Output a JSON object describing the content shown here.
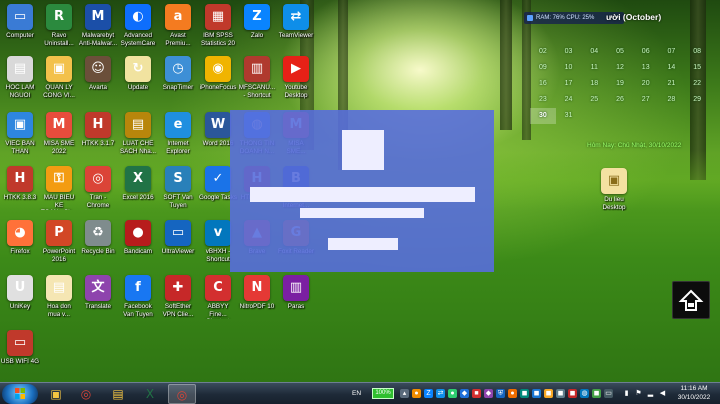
{
  "desktop_icons": [
    {
      "label": "Computer",
      "icon": "computer-icon",
      "color": "#3a7bd5",
      "glyph": "▭"
    },
    {
      "label": "Ravo\nUninstall...",
      "icon": "uninstaller-icon",
      "color": "#2b8a3e",
      "glyph": "R"
    },
    {
      "label": "Malwarebyt\nAnti-Malwar...",
      "icon": "malwarebytes-icon",
      "color": "#1b4fa8",
      "glyph": "M"
    },
    {
      "label": "Advanced\nSystemCare",
      "icon": "systemcare-icon",
      "color": "#0d6efd",
      "glyph": "◐"
    },
    {
      "label": "Avast\nPremiu...",
      "icon": "avast-icon",
      "color": "#f47b20",
      "glyph": "a"
    },
    {
      "label": "IBM SPSS\nStatistics 20",
      "icon": "spss-icon",
      "color": "#c0392b",
      "glyph": "▦"
    },
    {
      "label": "Zalo",
      "icon": "zalo-icon",
      "color": "#0a84ff",
      "glyph": "Z"
    },
    {
      "label": "TeamViewer",
      "icon": "teamviewer-icon",
      "color": "#0e8ee9",
      "glyph": "⇄"
    },
    {
      "label": "HOC LAM\nNGUOI",
      "icon": "document-icon",
      "color": "#d9d9d9",
      "glyph": "▤"
    },
    {
      "label": "QUAN LY\nCONG VI...",
      "icon": "folder-icon",
      "color": "#f3c14b",
      "glyph": "▣"
    },
    {
      "label": "Avarta",
      "icon": "photo-icon",
      "color": "#6b4f3a",
      "glyph": "☺"
    },
    {
      "label": "Update",
      "icon": "update-icon",
      "color": "#f1e3a0",
      "glyph": "↻"
    },
    {
      "label": "SnapTimer",
      "icon": "timer-icon",
      "color": "#3d8fd6",
      "glyph": "◷"
    },
    {
      "label": "iPhoneFocus",
      "icon": "iphonefocus-icon",
      "color": "#f0b400",
      "glyph": "◉"
    },
    {
      "label": "MFSCANU...\n- Shortcut",
      "icon": "scanner-icon",
      "color": "#b03a2e",
      "glyph": "▥"
    },
    {
      "label": "Youtube\nDesktop",
      "icon": "youtube-icon",
      "color": "#e62117",
      "glyph": "▶"
    },
    {
      "label": "VIEC BAN\nTHAN",
      "icon": "folder-icon",
      "color": "#2e86de",
      "glyph": "▣"
    },
    {
      "label": "MISA SME\n2022",
      "icon": "misa-icon",
      "color": "#e74c3c",
      "glyph": "M"
    },
    {
      "label": "HTKK 3.1.7",
      "icon": "htkk-icon",
      "color": "#c0392b",
      "glyph": "H"
    },
    {
      "label": "LUAT CHE\nSACH Nha...",
      "icon": "book-icon",
      "color": "#b8860b",
      "glyph": "▤"
    },
    {
      "label": "Internet\nExplorer",
      "icon": "internet-explorer-icon",
      "color": "#1f8fe0",
      "glyph": "e"
    },
    {
      "label": "Word 2016",
      "icon": "word-icon",
      "color": "#2b579a",
      "glyph": "W"
    },
    {
      "label": "THONG TIN\nDOANH N...",
      "icon": "globe-icon",
      "color": "#1e90ff",
      "glyph": "◍"
    },
    {
      "label": "MISA\nSME...",
      "icon": "misa-icon",
      "color": "#e74c3c",
      "glyph": "M"
    },
    {
      "label": "HTKK 3.8.3",
      "icon": "htkk-icon",
      "color": "#c0392b",
      "glyph": "H"
    },
    {
      "label": "MAU BIEU KE\nTOAN - Sh...",
      "icon": "key-icon",
      "color": "#f39c12",
      "glyph": "⚿"
    },
    {
      "label": "Tran -\nChrome",
      "icon": "chrome-icon",
      "color": "#db4437",
      "glyph": "◎"
    },
    {
      "label": "Excel 2016",
      "icon": "excel-icon",
      "color": "#217346",
      "glyph": "X"
    },
    {
      "label": "SOFT Van\nTuyen",
      "icon": "soft-icon",
      "color": "#2980b9",
      "glyph": "S"
    },
    {
      "label": "Google Tasks",
      "icon": "google-tasks-icon",
      "color": "#1a73e8",
      "glyph": "✓"
    },
    {
      "label": "HTKK 4.5.5",
      "icon": "htkk-icon",
      "color": "#c0392b",
      "glyph": "H"
    },
    {
      "label": "BKAV Pro\nInternet...",
      "icon": "bkav-icon",
      "color": "#0d47a1",
      "glyph": "B"
    },
    {
      "label": "Firefox",
      "icon": "firefox-icon",
      "color": "#ff7139",
      "glyph": "◕"
    },
    {
      "label": "PowerPoint\n2016",
      "icon": "powerpoint-icon",
      "color": "#d24726",
      "glyph": "P"
    },
    {
      "label": "Recycle Bin",
      "icon": "recycle-bin-icon",
      "color": "#7f8c8d",
      "glyph": "♻"
    },
    {
      "label": "Bandicam",
      "icon": "bandicam-icon",
      "color": "#b71c1c",
      "glyph": "●"
    },
    {
      "label": "UltraViewer",
      "icon": "ultraviewer-icon",
      "color": "#1565c0",
      "glyph": "▭"
    },
    {
      "label": "vBHXH -\nShortcut",
      "icon": "vbhxh-icon",
      "color": "#0277bd",
      "glyph": "v"
    },
    {
      "label": "Brave",
      "icon": "brave-icon",
      "color": "#fb542b",
      "glyph": "▲"
    },
    {
      "label": "Foxit Reader",
      "icon": "foxit-icon",
      "color": "#f57c00",
      "glyph": "G"
    },
    {
      "label": "UniKey",
      "icon": "unikey-icon",
      "color": "#e0e0e0",
      "glyph": "U"
    },
    {
      "label": "Hoa don\nmua v...",
      "icon": "invoice-icon",
      "color": "#f5e6b3",
      "glyph": "▤"
    },
    {
      "label": "Translate",
      "icon": "translate-icon",
      "color": "#8e44ad",
      "glyph": "文"
    },
    {
      "label": "Facebook\nVan Tuyen",
      "icon": "facebook-icon",
      "color": "#1877f2",
      "glyph": "f"
    },
    {
      "label": "SoftEther\nVPN Clie...",
      "icon": "vpn-icon",
      "color": "#c62828",
      "glyph": "✚"
    },
    {
      "label": "ABBYY Fine...\nShortcut",
      "icon": "abbyy-icon",
      "color": "#d32f2f",
      "glyph": "C"
    },
    {
      "label": "NitroPDF 10",
      "icon": "nitro-pdf-icon",
      "color": "#e53935",
      "glyph": "N"
    },
    {
      "label": "Paras",
      "icon": "archive-icon",
      "color": "#7b1fa2",
      "glyph": "▥"
    },
    {
      "label": "USB WIFI 4G",
      "icon": "usb-wifi-icon",
      "color": "#c0392b",
      "glyph": "▭"
    }
  ],
  "desktop_file": {
    "label": "Du lieu\nDesktop",
    "icon": "folder-icon",
    "color": "#f4e1a1",
    "glyph": "▣"
  },
  "calendar": {
    "meter": "RAM: 76%  CPU: 25%",
    "month_title": "ười (October)",
    "days": [
      "",
      "",
      "",
      "",
      "",
      "",
      "",
      "02",
      "03",
      "04",
      "05",
      "06",
      "07",
      "08",
      "09",
      "10",
      "11",
      "12",
      "13",
      "14",
      "15",
      "16",
      "17",
      "18",
      "19",
      "20",
      "21",
      "22",
      "23",
      "24",
      "25",
      "26",
      "27",
      "28",
      "29",
      "30",
      "31",
      "",
      "",
      "",
      "",
      ""
    ],
    "today": "30",
    "footer": "Hôm Nay: Chủ Nhật, 30/10/2022"
  },
  "taskbar": {
    "apps": [
      {
        "icon": "folder-icon",
        "color": "#f4c542",
        "glyph": "▣",
        "active": false
      },
      {
        "icon": "chrome-icon",
        "color": "#db4437",
        "glyph": "◎",
        "active": false
      },
      {
        "icon": "explorer-icon",
        "color": "#f4c542",
        "glyph": "▤",
        "active": false
      },
      {
        "icon": "excel-icon",
        "color": "#217346",
        "glyph": "X",
        "active": false
      },
      {
        "icon": "chrome-icon",
        "color": "#db4437",
        "glyph": "◎",
        "active": true
      }
    ],
    "lang": "EN",
    "battery": "100%",
    "time": "11:16 AM",
    "date": "30/10/2022"
  },
  "scroll_button": {
    "glyph": "⇧",
    "icon": "scroll-to-top-icon"
  }
}
